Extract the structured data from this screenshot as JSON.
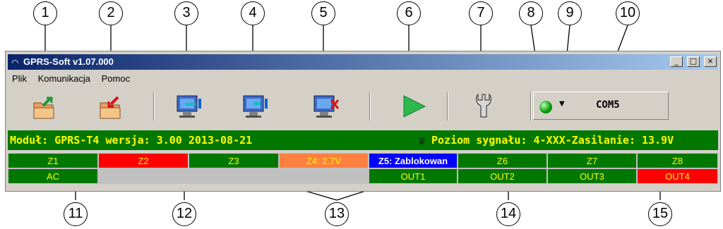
{
  "callouts": [
    "1",
    "2",
    "3",
    "4",
    "5",
    "6",
    "7",
    "8",
    "9",
    "10",
    "11",
    "12",
    "13",
    "14",
    "15"
  ],
  "window": {
    "title": "GPRS-Soft v1.07.000",
    "controls": {
      "minimize": "_",
      "maximize": "□",
      "close": "×"
    }
  },
  "menu": [
    {
      "label": "Plik"
    },
    {
      "label": "Komunikacja"
    },
    {
      "label": "Pomoc"
    }
  ],
  "toolbar": {
    "buttons": [
      {
        "icon": "folder-open-icon"
      },
      {
        "icon": "folder-save-icon"
      },
      {
        "icon": "monitor-connect-icon"
      },
      {
        "icon": "monitor-send-icon"
      },
      {
        "icon": "monitor-disconnect-icon"
      },
      {
        "icon": "play-icon"
      },
      {
        "icon": "wrench-icon"
      }
    ],
    "connection_led_color": "#0aa00a",
    "port": "COM5"
  },
  "status": {
    "module": "Moduł: GPRS-T4 wersja: 3.00  2013-08-21",
    "signal": "Poziom sygnału: 4-XXX-Zasilanie: 13.9V",
    "antenna_icon": "antenna-icon"
  },
  "zones": [
    "Z1",
    "Z2",
    "Z3",
    "Z4: 2.7V",
    "Z5: Zablokowan",
    "Z6",
    "Z7",
    "Z8"
  ],
  "bottom_row": [
    "AC",
    "",
    "",
    "",
    "OUT1",
    "OUT2",
    "OUT3",
    "OUT4"
  ],
  "colors": {
    "green": "#007800",
    "red": "#ff0000",
    "orange": "#ff8040",
    "blue": "#0000ff",
    "gray": "#c0c0c0",
    "yellow_text": "#ffff00"
  }
}
